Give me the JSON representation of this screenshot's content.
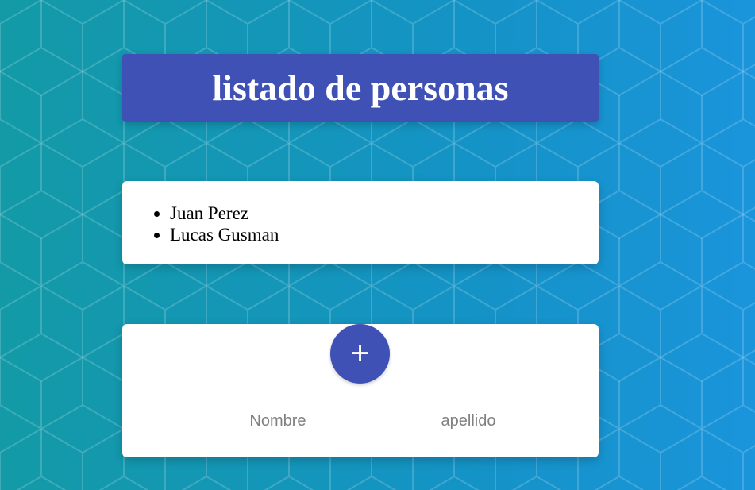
{
  "header": {
    "title": "listado de personas"
  },
  "people": {
    "items": [
      "Juan Perez",
      "Lucas Gusman"
    ]
  },
  "form": {
    "add_label": "+",
    "nombre_placeholder": "Nombre",
    "apellido_placeholder": "apellido"
  },
  "colors": {
    "primary": "#3f51b5",
    "background_start": "#139aa6",
    "background_end": "#1a94db",
    "card": "#ffffff"
  },
  "icons": {
    "add": "plus-icon"
  }
}
